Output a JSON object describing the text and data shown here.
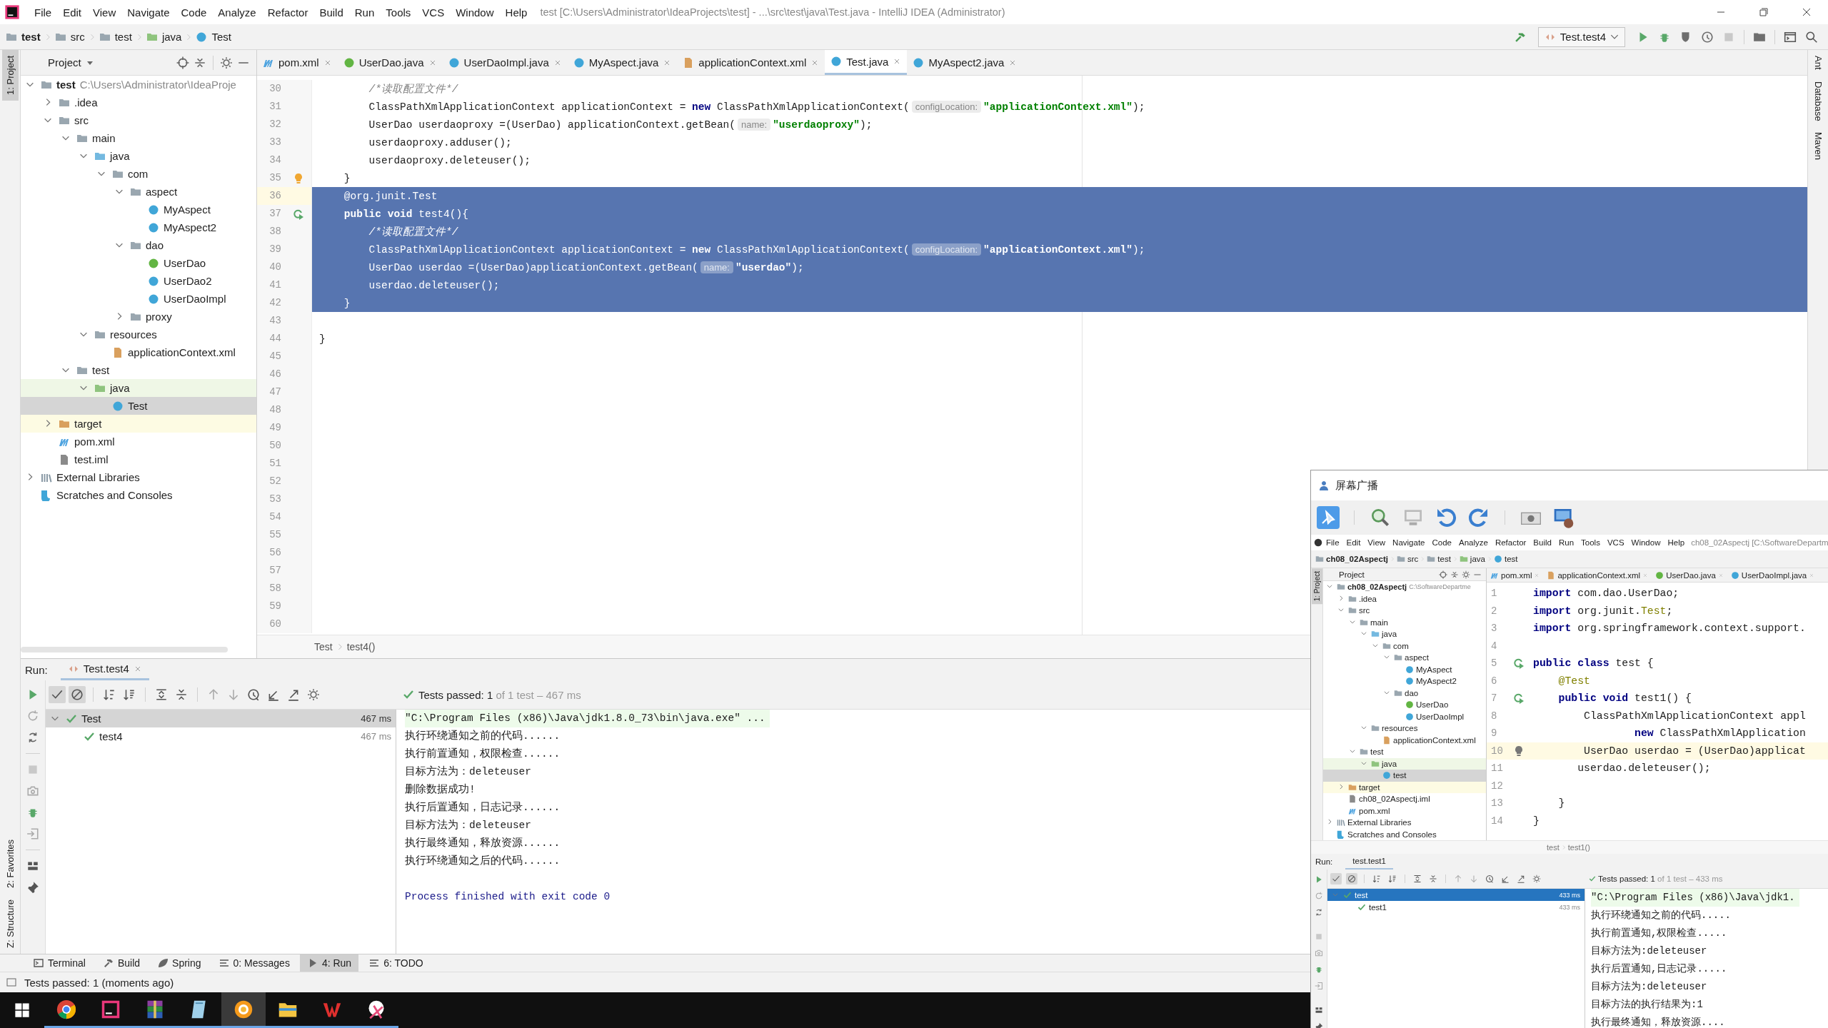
{
  "menu_bar": {
    "items": [
      "File",
      "Edit",
      "View",
      "Navigate",
      "Code",
      "Analyze",
      "Refactor",
      "Build",
      "Run",
      "Tools",
      "VCS",
      "Window",
      "Help"
    ],
    "title": "test [C:\\Users\\Administrator\\IdeaProjects\\test] - ...\\src\\test\\java\\Test.java - IntelliJ IDEA (Administrator)"
  },
  "navigation_bar": {
    "breadcrumbs": [
      {
        "label": "test",
        "kind": "module"
      },
      {
        "label": "src",
        "kind": "folder"
      },
      {
        "label": "test",
        "kind": "folder"
      },
      {
        "label": "java",
        "kind": "test-folder"
      },
      {
        "label": "Test",
        "kind": "test-class"
      }
    ],
    "run_configuration": "Test.test4"
  },
  "left_tool_strip": {
    "top": [
      {
        "label": "1: Project",
        "selected": true
      }
    ],
    "bottom": [
      {
        "label": "2: Favorites",
        "selected": false
      },
      {
        "label": "Z: Structure",
        "selected": false
      }
    ]
  },
  "right_tool_strip": [
    "Ant",
    "Database",
    "Maven"
  ],
  "project_panel": {
    "title": "Project",
    "tree": [
      {
        "label": "test",
        "kind": "module",
        "hint": "C:\\Users\\Administrator\\IdeaProje",
        "expanded": true,
        "selected": false,
        "children": [
          {
            "label": ".idea",
            "kind": "folder",
            "expanded": false,
            "selected": false
          },
          {
            "label": "src",
            "kind": "folder",
            "expanded": true,
            "selected": false,
            "children": [
              {
                "label": "main",
                "kind": "folder",
                "expanded": true,
                "selected": false,
                "children": [
                  {
                    "label": "java",
                    "kind": "source-folder",
                    "expanded": true,
                    "selected": false,
                    "children": [
                      {
                        "label": "com",
                        "kind": "package",
                        "expanded": true,
                        "selected": false,
                        "children": [
                          {
                            "label": "aspect",
                            "kind": "package",
                            "expanded": true,
                            "selected": false,
                            "children": [
                              {
                                "label": "MyAspect",
                                "kind": "class",
                                "selected": false
                              },
                              {
                                "label": "MyAspect2",
                                "kind": "class",
                                "selected": false
                              }
                            ]
                          },
                          {
                            "label": "dao",
                            "kind": "package",
                            "expanded": true,
                            "selected": false,
                            "children": [
                              {
                                "label": "UserDao",
                                "kind": "interface",
                                "selected": false
                              },
                              {
                                "label": "UserDao2",
                                "kind": "class",
                                "selected": false
                              },
                              {
                                "label": "UserDaoImpl",
                                "kind": "class",
                                "selected": false
                              }
                            ]
                          },
                          {
                            "label": "proxy",
                            "kind": "package",
                            "expanded": false,
                            "selected": false
                          }
                        ]
                      }
                    ]
                  },
                  {
                    "label": "resources",
                    "kind": "resources-folder",
                    "expanded": true,
                    "selected": false,
                    "children": [
                      {
                        "label": "applicationContext.xml",
                        "kind": "xml",
                        "selected": false
                      }
                    ]
                  }
                ]
              },
              {
                "label": "test",
                "kind": "folder",
                "expanded": true,
                "selected": false,
                "children": [
                  {
                    "label": "java",
                    "kind": "test-folder",
                    "expanded": true,
                    "selected": false,
                    "children": [
                      {
                        "label": "Test",
                        "kind": "test-class",
                        "selected": true
                      }
                    ]
                  }
                ]
              }
            ]
          },
          {
            "label": "target",
            "kind": "excluded-folder",
            "expanded": false,
            "selected": false
          },
          {
            "label": "pom.xml",
            "kind": "maven",
            "selected": false
          },
          {
            "label": "test.iml",
            "kind": "iml",
            "selected": false
          }
        ]
      },
      {
        "label": "External Libraries",
        "kind": "libraries",
        "expanded": false,
        "selected": false
      },
      {
        "label": "Scratches and Consoles",
        "kind": "scratches",
        "selected": false
      }
    ]
  },
  "editor": {
    "tabs": [
      {
        "label": "pom.xml",
        "kind": "maven",
        "selected": false
      },
      {
        "label": "UserDao.java",
        "kind": "interface",
        "selected": false
      },
      {
        "label": "UserDaoImpl.java",
        "kind": "class",
        "selected": false
      },
      {
        "label": "MyAspect.java",
        "kind": "class",
        "selected": false
      },
      {
        "label": "applicationContext.xml",
        "kind": "xml",
        "selected": false
      },
      {
        "label": "Test.java",
        "kind": "test-class",
        "selected": true
      },
      {
        "label": "MyAspect2.java",
        "kind": "class",
        "selected": false
      }
    ],
    "lines": [
      {
        "number": "30",
        "kind": "plain",
        "selected": false,
        "current": false,
        "tokens": [
          {
            "kind": "comment",
            "text": "        /*读取配置文件*/"
          }
        ]
      },
      {
        "number": "31",
        "kind": "plain",
        "selected": false,
        "current": false,
        "tokens": [
          {
            "kind": "plain",
            "text": "        ClassPathXmlApplicationContext applicationContext = "
          },
          {
            "kind": "keyword",
            "text": "new"
          },
          {
            "kind": "plain",
            "text": " ClassPathXmlApplicationContext("
          },
          {
            "kind": "hint",
            "text": "configLocation:"
          },
          {
            "kind": "string",
            "text": "\"applicationContext.xml\""
          },
          {
            "kind": "plain",
            "text": ");"
          }
        ]
      },
      {
        "number": "32",
        "kind": "plain",
        "selected": false,
        "current": false,
        "tokens": [
          {
            "kind": "plain",
            "text": "        UserDao userdaoproxy =(UserDao) applicationContext.getBean("
          },
          {
            "kind": "hint",
            "text": "name:"
          },
          {
            "kind": "string",
            "text": "\"userdaoproxy\""
          },
          {
            "kind": "plain",
            "text": ");"
          }
        ]
      },
      {
        "number": "33",
        "kind": "plain",
        "selected": false,
        "current": false,
        "tokens": [
          {
            "kind": "plain",
            "text": "        userdaoproxy.adduser();"
          }
        ]
      },
      {
        "number": "34",
        "kind": "plain",
        "selected": false,
        "current": false,
        "tokens": [
          {
            "kind": "plain",
            "text": "        userdaoproxy.deleteuser();"
          }
        ]
      },
      {
        "number": "35",
        "kind": "bulb",
        "selected": false,
        "current": false,
        "tokens": [
          {
            "kind": "plain",
            "text": "    }"
          }
        ]
      },
      {
        "number": "36",
        "kind": "plain",
        "selected": true,
        "current": true,
        "tokens": [
          {
            "kind": "annotation",
            "text": "    @org.junit.Test"
          }
        ]
      },
      {
        "number": "37",
        "kind": "run",
        "selected": true,
        "current": false,
        "tokens": [
          {
            "kind": "keyword",
            "text": "    public void"
          },
          {
            "kind": "plain",
            "text": " test4(){"
          }
        ]
      },
      {
        "number": "38",
        "kind": "plain",
        "selected": true,
        "current": false,
        "tokens": [
          {
            "kind": "comment",
            "text": "        /*读取配置文件*/"
          }
        ]
      },
      {
        "number": "39",
        "kind": "plain",
        "selected": true,
        "current": false,
        "tokens": [
          {
            "kind": "plain",
            "text": "        ClassPathXmlApplicationContext applicationContext = "
          },
          {
            "kind": "keyword",
            "text": "new"
          },
          {
            "kind": "plain",
            "text": " ClassPathXmlApplicationContext("
          },
          {
            "kind": "hint",
            "text": "configLocation:"
          },
          {
            "kind": "string",
            "text": "\"applicationContext.xml\""
          },
          {
            "kind": "plain",
            "text": ");"
          }
        ]
      },
      {
        "number": "40",
        "kind": "plain",
        "selected": true,
        "current": false,
        "tokens": [
          {
            "kind": "plain",
            "text": "        UserDao userdao =(UserDao)applicationContext.getBean("
          },
          {
            "kind": "hint",
            "text": "name:"
          },
          {
            "kind": "string",
            "text": "\"userdao\""
          },
          {
            "kind": "plain",
            "text": ");"
          }
        ]
      },
      {
        "number": "41",
        "kind": "plain",
        "selected": true,
        "current": false,
        "tokens": [
          {
            "kind": "plain",
            "text": "        userdao.deleteuser();"
          }
        ]
      },
      {
        "number": "42",
        "kind": "plain",
        "selected": true,
        "current": false,
        "tokens": [
          {
            "kind": "plain",
            "text": "    }"
          }
        ]
      },
      {
        "number": "43",
        "kind": "plain",
        "selected": false,
        "current": false
      },
      {
        "number": "44",
        "kind": "plain",
        "selected": false,
        "current": false,
        "tokens": [
          {
            "kind": "plain",
            "text": "}"
          }
        ]
      },
      {
        "number": "45",
        "kind": "plain",
        "selected": false,
        "current": false
      },
      {
        "number": "46",
        "kind": "plain",
        "selected": false,
        "current": false
      },
      {
        "number": "47",
        "kind": "plain",
        "selected": false,
        "current": false
      },
      {
        "number": "48",
        "kind": "plain",
        "selected": false,
        "current": false
      },
      {
        "number": "49",
        "kind": "plain",
        "selected": false,
        "current": false
      },
      {
        "number": "50",
        "kind": "plain",
        "selected": false,
        "current": false
      },
      {
        "number": "51",
        "kind": "plain",
        "selected": false,
        "current": false
      },
      {
        "number": "52",
        "kind": "plain",
        "selected": false,
        "current": false
      },
      {
        "number": "53",
        "kind": "plain",
        "selected": false,
        "current": false
      },
      {
        "number": "54",
        "kind": "plain",
        "selected": false,
        "current": false
      },
      {
        "number": "55",
        "kind": "plain",
        "selected": false,
        "current": false
      },
      {
        "number": "56",
        "kind": "plain",
        "selected": false,
        "current": false
      },
      {
        "number": "57",
        "kind": "plain",
        "selected": false,
        "current": false
      },
      {
        "number": "58",
        "kind": "plain",
        "selected": false,
        "current": false
      },
      {
        "number": "59",
        "kind": "plain",
        "selected": false,
        "current": false
      },
      {
        "number": "60",
        "kind": "plain",
        "selected": false,
        "current": false
      }
    ],
    "breadcrumbs": [
      "Test",
      "test4()"
    ]
  },
  "run_panel": {
    "label": "Run:",
    "tab": "Test.test4",
    "toolbar_toggles": [
      {
        "selected": true
      },
      {
        "selected": true
      }
    ],
    "summary": "Tests passed: 1",
    "summary_detail": "of 1 test – 467 ms",
    "tests": [
      {
        "name": "Test",
        "time": "467 ms",
        "passed": true,
        "selected": true,
        "children": [
          {
            "name": "test4",
            "time": "467 ms",
            "passed": true,
            "selected": false
          }
        ]
      }
    ],
    "console": [
      {
        "kind": "command",
        "text": "\"C:\\Program Files (x86)\\Java\\jdk1.8.0_73\\bin\\java.exe\" ..."
      },
      {
        "kind": "output",
        "text": "执行环绕通知之前的代码......"
      },
      {
        "kind": "output",
        "text": "执行前置通知，权限检查......"
      },
      {
        "kind": "output",
        "text": "目标方法为：deleteuser"
      },
      {
        "kind": "output",
        "text": "删除数据成功!"
      },
      {
        "kind": "output",
        "text": "执行后置通知，日志记录......"
      },
      {
        "kind": "output",
        "text": "目标方法为：deleteuser"
      },
      {
        "kind": "output",
        "text": "执行最终通知，释放资源......"
      },
      {
        "kind": "output",
        "text": "执行环绕通知之后的代码......"
      },
      {
        "kind": "exit",
        "text": "Process finished with exit code 0"
      }
    ]
  },
  "tool_window_tabs": [
    {
      "label": "Terminal",
      "selected": false
    },
    {
      "label": "Build",
      "selected": false
    },
    {
      "label": "Spring",
      "selected": false
    },
    {
      "label": "0: Messages",
      "selected": false
    },
    {
      "label": "4: Run",
      "selected": true
    },
    {
      "label": "6: TODO",
      "selected": false
    }
  ],
  "status_bar": "Tests passed: 1 (moments ago)",
  "taskbar": {
    "apps": [
      {
        "selected": false
      },
      {
        "selected": false
      },
      {
        "selected": false
      },
      {
        "selected": false
      },
      {
        "selected": true
      },
      {
        "selected": false
      },
      {
        "selected": false
      },
      {
        "selected": false
      }
    ]
  },
  "screen_broadcast": {
    "title": "屏幕广播",
    "menu_bar": {
      "items": [
        "File",
        "Edit",
        "View",
        "Navigate",
        "Code",
        "Analyze",
        "Refactor",
        "Build",
        "Run",
        "Tools",
        "VCS",
        "Window",
        "Help"
      ],
      "title": "ch08_02Aspectj [C:\\SoftwareDepartm"
    },
    "breadcrumbs": [
      {
        "label": "ch08_02Aspectj",
        "kind": "module"
      },
      {
        "label": "src",
        "kind": "folder"
      },
      {
        "label": "test",
        "kind": "folder"
      },
      {
        "label": "java",
        "kind": "test-folder"
      },
      {
        "label": "test",
        "kind": "test-class"
      }
    ],
    "left_tool_label": "1: Project",
    "project_panel": {
      "title": "Project",
      "tree": [
        {
          "label": "ch08_02Aspectj",
          "kind": "module",
          "hint": "C:\\SoftwareDepartme",
          "expanded": true,
          "selected": false,
          "children": [
            {
              "label": ".idea",
              "kind": "folder",
              "expanded": false,
              "selected": false
            },
            {
              "label": "src",
              "kind": "folder",
              "expanded": true,
              "selected": false,
              "children": [
                {
                  "label": "main",
                  "kind": "folder",
                  "expanded": true,
                  "selected": false,
                  "children": [
                    {
                      "label": "java",
                      "kind": "source-folder",
                      "expanded": true,
                      "selected": false,
                      "children": [
                        {
                          "label": "com",
                          "kind": "package",
                          "expanded": true,
                          "selected": false,
                          "children": [
                            {
                              "label": "aspect",
                              "kind": "package",
                              "expanded": true,
                              "selected": false,
                              "children": [
                                {
                                  "label": "MyAspect",
                                  "kind": "class",
                                  "selected": false
                                },
                                {
                                  "label": "MyAspect2",
                                  "kind": "class",
                                  "selected": false
                                }
                              ]
                            },
                            {
                              "label": "dao",
                              "kind": "package",
                              "expanded": true,
                              "selected": false,
                              "children": [
                                {
                                  "label": "UserDao",
                                  "kind": "interface",
                                  "selected": false
                                },
                                {
                                  "label": "UserDaoImpl",
                                  "kind": "class",
                                  "selected": false
                                }
                              ]
                            }
                          ]
                        }
                      ]
                    },
                    {
                      "label": "resources",
                      "kind": "resources-folder",
                      "expanded": true,
                      "selected": false,
                      "children": [
                        {
                          "label": "applicationContext.xml",
                          "kind": "xml",
                          "selected": false
                        }
                      ]
                    }
                  ]
                },
                {
                  "label": "test",
                  "kind": "folder",
                  "expanded": true,
                  "selected": false,
                  "children": [
                    {
                      "label": "java",
                      "kind": "test-folder",
                      "expanded": true,
                      "selected": false,
                      "children": [
                        {
                          "label": "test",
                          "kind": "test-class",
                          "selected": true
                        }
                      ]
                    }
                  ]
                }
              ]
            },
            {
              "label": "target",
              "kind": "excluded-folder",
              "expanded": false,
              "selected": false
            },
            {
              "label": "ch08_02Aspectj.iml",
              "kind": "iml",
              "selected": false
            },
            {
              "label": "pom.xml",
              "kind": "maven",
              "selected": false
            }
          ]
        },
        {
          "label": "External Libraries",
          "kind": "libraries",
          "expanded": false,
          "selected": false
        },
        {
          "label": "Scratches and Consoles",
          "kind": "scratches",
          "selected": false
        }
      ]
    },
    "editor": {
      "tabs": [
        {
          "label": "pom.xml",
          "kind": "maven",
          "selected": false
        },
        {
          "label": "applicationContext.xml",
          "kind": "xml",
          "selected": false
        },
        {
          "label": "UserDao.java",
          "kind": "interface",
          "selected": false
        },
        {
          "label": "UserDaoImpl.java",
          "kind": "class",
          "selected": false
        }
      ],
      "lines": [
        {
          "number": "1",
          "kind": "plain",
          "selected": false,
          "current": false,
          "tokens": [
            {
              "kind": "keyword",
              "text": "import"
            },
            {
              "kind": "plain",
              "text": " com.dao.UserDao;"
            }
          ]
        },
        {
          "number": "2",
          "kind": "plain",
          "selected": false,
          "current": false,
          "tokens": [
            {
              "kind": "keyword",
              "text": "import"
            },
            {
              "kind": "plain",
              "text": " org.junit."
            },
            {
              "kind": "annotation",
              "text": "Test"
            },
            {
              "kind": "plain",
              "text": ";"
            }
          ]
        },
        {
          "number": "3",
          "kind": "plain",
          "selected": false,
          "current": false,
          "tokens": [
            {
              "kind": "keyword",
              "text": "import"
            },
            {
              "kind": "plain",
              "text": " org.springframework.context.support."
            }
          ]
        },
        {
          "number": "4",
          "kind": "plain",
          "selected": false,
          "current": false
        },
        {
          "number": "5",
          "kind": "run",
          "selected": false,
          "current": false,
          "tokens": [
            {
              "kind": "keyword",
              "text": "public class"
            },
            {
              "kind": "plain",
              "text": " test {"
            }
          ]
        },
        {
          "number": "6",
          "kind": "plain",
          "selected": false,
          "current": false,
          "tokens": [
            {
              "kind": "annotation",
              "text": "    @Test"
            }
          ]
        },
        {
          "number": "7",
          "kind": "run",
          "selected": false,
          "current": false,
          "tokens": [
            {
              "kind": "keyword",
              "text": "    public void"
            },
            {
              "kind": "plain",
              "text": " test1() {"
            }
          ]
        },
        {
          "number": "8",
          "kind": "plain",
          "selected": false,
          "current": false,
          "tokens": [
            {
              "kind": "plain",
              "text": "        ClassPathXmlApplicationContext appl"
            }
          ]
        },
        {
          "number": "9",
          "kind": "plain",
          "selected": false,
          "current": false,
          "tokens": [
            {
              "kind": "keyword",
              "text": "                new"
            },
            {
              "kind": "plain",
              "text": " ClassPathXmlApplication"
            }
          ]
        },
        {
          "number": "10",
          "kind": "bulb",
          "selected": false,
          "current": true,
          "tokens": [
            {
              "kind": "plain",
              "text": "        UserDao userdao = (UserDao)applicat"
            }
          ]
        },
        {
          "number": "11",
          "kind": "plain",
          "selected": false,
          "current": false,
          "tokens": [
            {
              "kind": "plain",
              "text": "       userdao.deleteuser();"
            }
          ]
        },
        {
          "number": "12",
          "kind": "plain",
          "selected": false,
          "current": false
        },
        {
          "number": "13",
          "kind": "plain",
          "selected": false,
          "current": false,
          "tokens": [
            {
              "kind": "plain",
              "text": "    }"
            }
          ]
        },
        {
          "number": "14",
          "kind": "plain",
          "selected": false,
          "current": false,
          "tokens": [
            {
              "kind": "plain",
              "text": "}"
            }
          ]
        }
      ],
      "breadcrumbs": [
        "test",
        "test1()"
      ]
    },
    "run_panel": {
      "label": "Run:",
      "tab": "test.test1",
      "toolbar_toggles": [
        {
          "selected": true
        },
        {
          "selected": true
        }
      ],
      "summary": "Tests passed: 1",
      "summary_detail": "of 1 test – 433 ms",
      "tests": [
        {
          "name": "test",
          "time": "433 ms",
          "passed": true,
          "selected": true,
          "children": [
            {
              "name": "test1",
              "time": "433 ms",
              "passed": true,
              "selected": false
            }
          ]
        }
      ],
      "console": [
        {
          "kind": "command",
          "text": "\"C:\\Program Files (x86)\\Java\\jdk1."
        },
        {
          "kind": "output",
          "text": "执行环绕通知之前的代码....."
        },
        {
          "kind": "output",
          "text": "执行前置通知,权限检查....."
        },
        {
          "kind": "output",
          "text": "目标方法为:deleteuser"
        },
        {
          "kind": "output",
          "text": "执行后置通知,日志记录....."
        },
        {
          "kind": "output",
          "text": "目标方法为:deleteuser"
        },
        {
          "kind": "output",
          "text": "目标方法的执行结果为:1"
        },
        {
          "kind": "output",
          "text": "执行最终通知，释放资源...."
        }
      ]
    }
  }
}
